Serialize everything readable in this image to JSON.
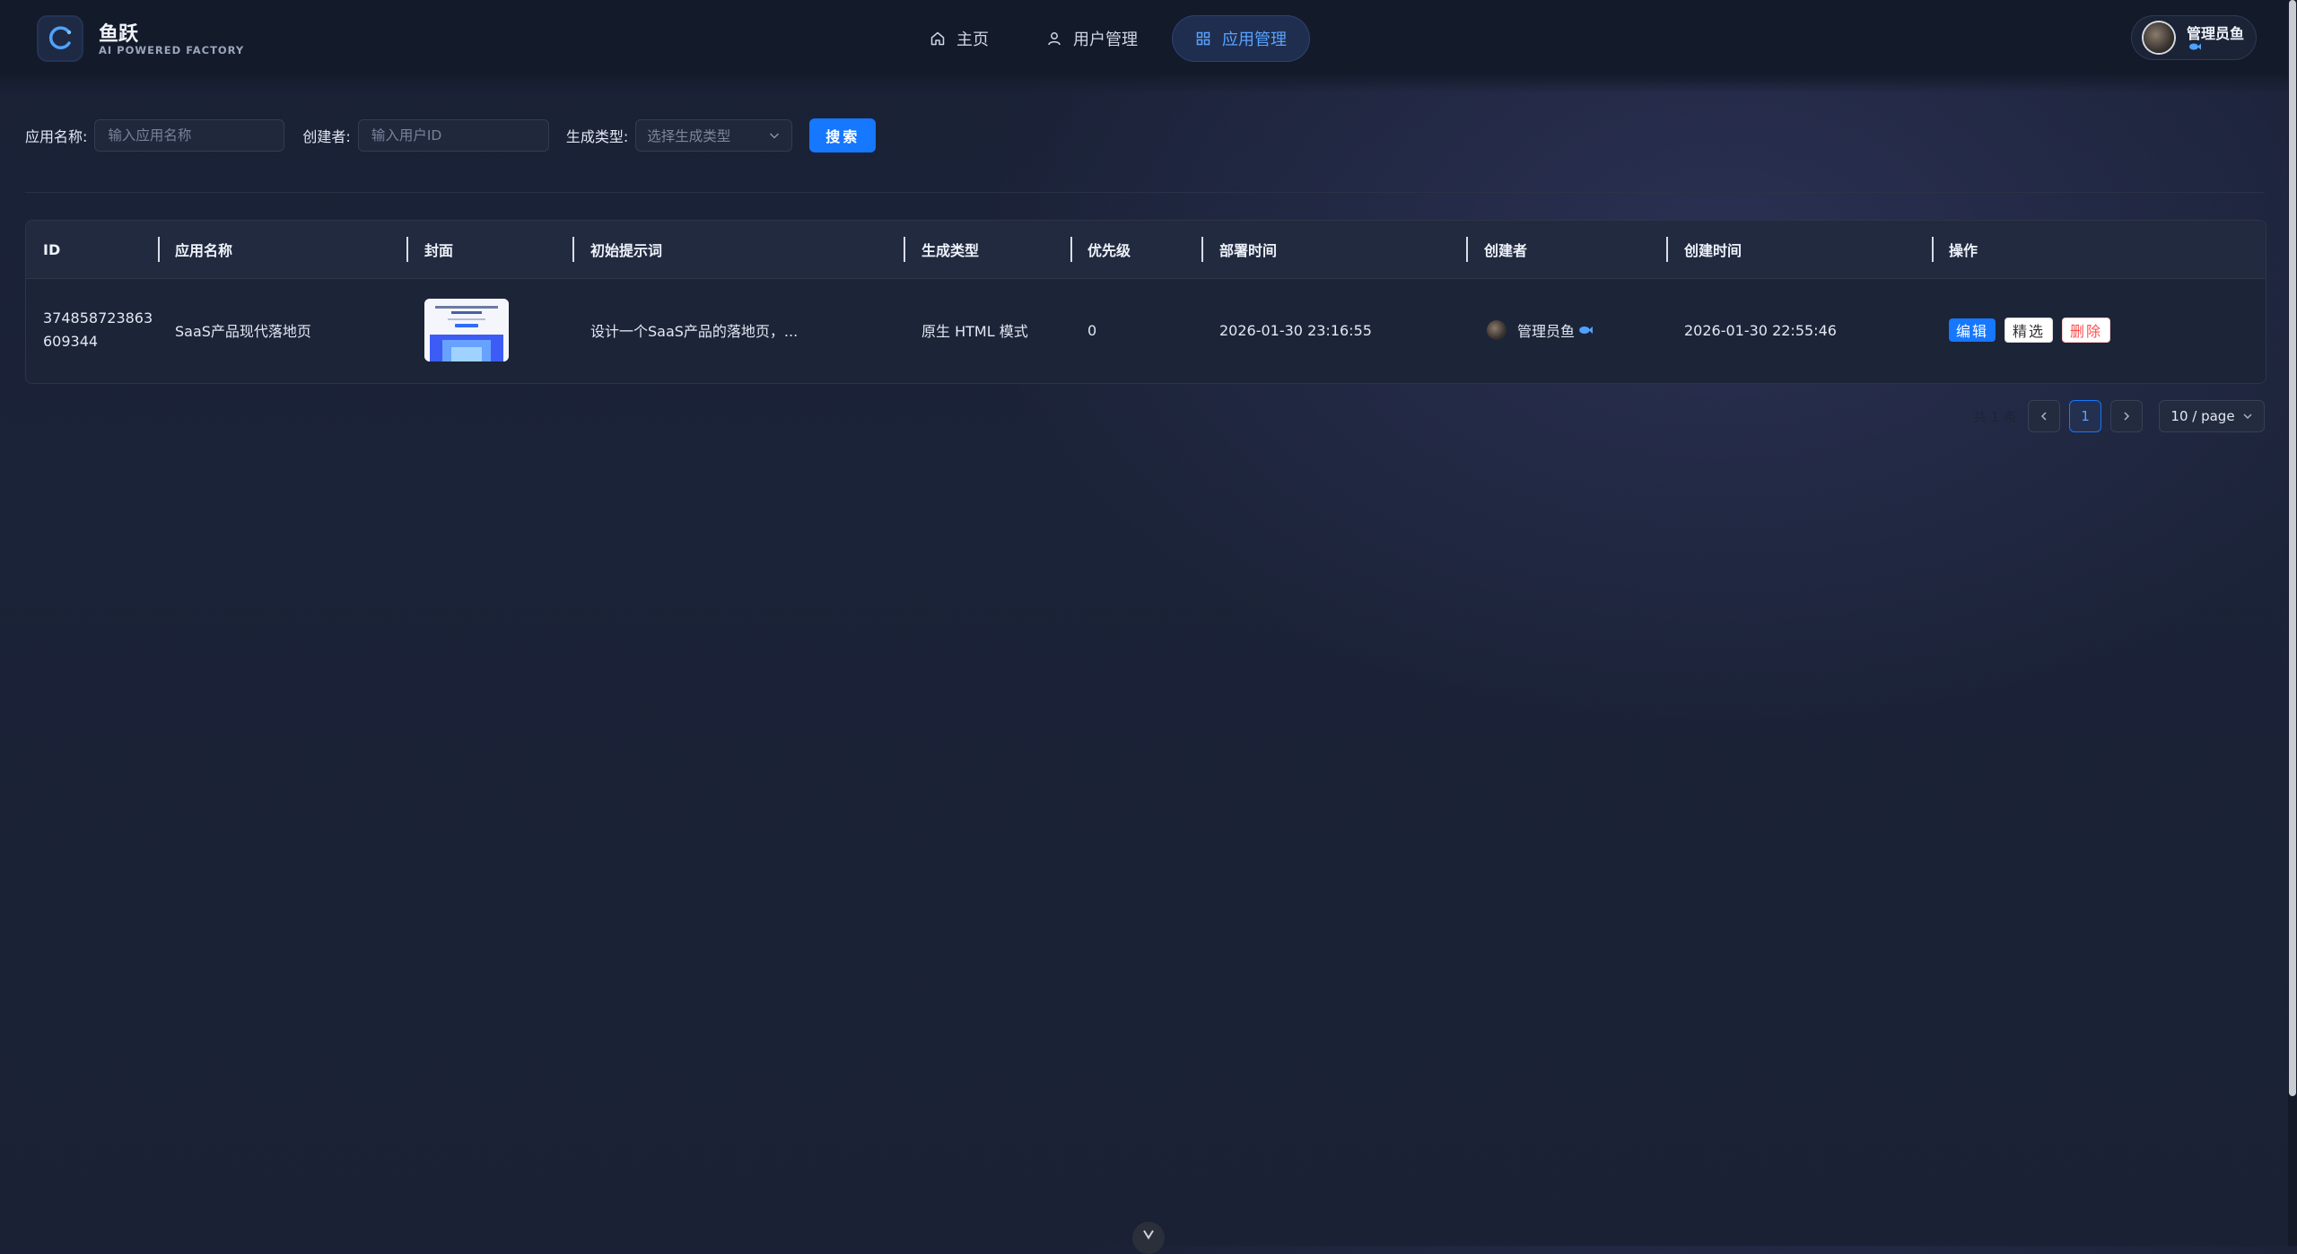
{
  "brand": {
    "name": "鱼跃",
    "subtitle": "AI POWERED FACTORY"
  },
  "nav": {
    "items": [
      {
        "label": "主页",
        "icon": "home-icon",
        "active": false
      },
      {
        "label": "用户管理",
        "icon": "user-icon",
        "active": false
      },
      {
        "label": "应用管理",
        "icon": "grid-icon",
        "active": true
      }
    ]
  },
  "user": {
    "name": "管理员鱼",
    "badge_icon": "fish-icon"
  },
  "filters": {
    "app_name": {
      "label": "应用名称:",
      "placeholder": "输入应用名称"
    },
    "creator": {
      "label": "创建者:",
      "placeholder": "输入用户ID"
    },
    "gen_type": {
      "label": "生成类型:",
      "placeholder": "选择生成类型"
    },
    "search_label": "搜索"
  },
  "table": {
    "headers": {
      "id": "ID",
      "app_name": "应用名称",
      "cover": "封面",
      "prompt": "初始提示词",
      "gen_type": "生成类型",
      "priority": "优先级",
      "deploy_time": "部署时间",
      "creator": "创建者",
      "create_time": "创建时间",
      "actions": "操作"
    },
    "rows": [
      {
        "id_line1": "374858723863",
        "id_line2": "609344",
        "app_name": "SaaS产品现代落地页",
        "prompt": "设计一个SaaS产品的落地页，...",
        "gen_type": "原生 HTML 模式",
        "priority": "0",
        "deploy_time": "2026-01-30 23:16:55",
        "creator": "管理员鱼",
        "create_time": "2026-01-30 22:55:46",
        "actions": {
          "edit": "编辑",
          "feature": "精选",
          "delete": "删除"
        }
      }
    ]
  },
  "pagination": {
    "total": "共 1 条",
    "current": "1",
    "page_size": "10 / page"
  },
  "colors": {
    "primary": "#1677ff",
    "danger": "#ff4d4f",
    "bg": "#1a2136",
    "header_bg": "#131a2a"
  }
}
